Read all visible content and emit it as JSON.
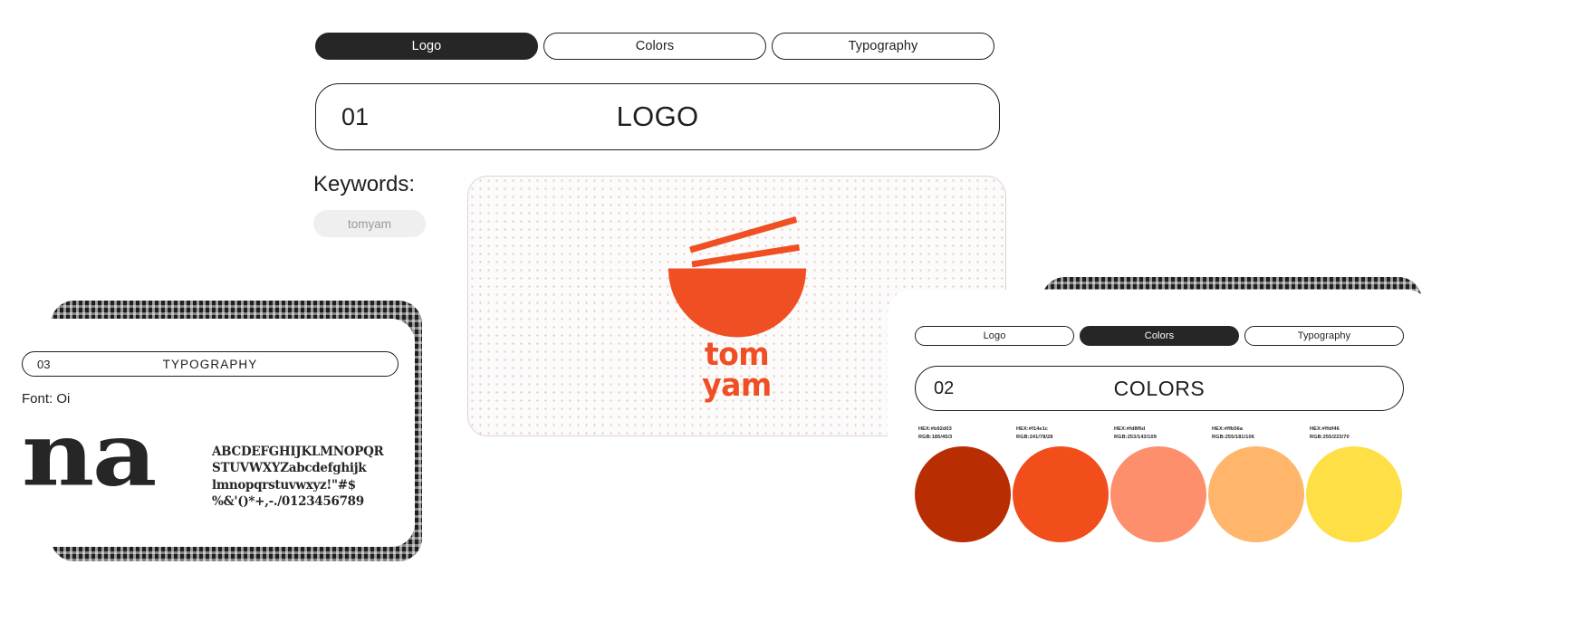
{
  "logo_panel": {
    "tabs": [
      {
        "label": "Logo",
        "active": true
      },
      {
        "label": "Colors",
        "active": false
      },
      {
        "label": "Typography",
        "active": false
      }
    ],
    "section": {
      "number": "01",
      "name": "LOGO"
    },
    "keywords": {
      "label": "Keywords:",
      "tags": [
        "tomyam"
      ]
    },
    "artwork": {
      "name": "tom-yam-bowl-logo",
      "wordmark_line1": "tom",
      "wordmark_line2": "yam",
      "brand_color": "#f04e23"
    }
  },
  "typography_panel": {
    "section": {
      "number": "03",
      "name": "TYPOGRAPHY"
    },
    "font_label": "Font: Oi",
    "specimen_large": "na",
    "glyph_lines": [
      "ABCDEFGHIJKLMNOPQR",
      "STUVWXYZabcdefghijk",
      "lmnopqrstuvwxyz!\"#$",
      "%&'()*+,-./0123456789"
    ]
  },
  "colors_panel": {
    "tabs": [
      {
        "label": "Logo",
        "active": false
      },
      {
        "label": "Colors",
        "active": true
      },
      {
        "label": "Typography",
        "active": false
      }
    ],
    "section": {
      "number": "02",
      "name": "COLORS"
    },
    "swatches": [
      {
        "hex_label": "HEX:#b92d03",
        "rgb_label": "RGB:185/45/3",
        "hex": "#b92d03"
      },
      {
        "hex_label": "HEX:#f14e1c",
        "rgb_label": "RGB:241/78/28",
        "hex": "#f14e1c"
      },
      {
        "hex_label": "HEX:#fd8f6d",
        "rgb_label": "RGB:253/143/109",
        "hex": "#fd8f6d"
      },
      {
        "hex_label": "HEX:#ffb56a",
        "rgb_label": "RGB:255/181/106",
        "hex": "#ffb56a"
      },
      {
        "hex_label": "HEX:#ffdf46",
        "rgb_label": "RGB:255/223/70",
        "hex": "#ffdf46"
      }
    ]
  }
}
